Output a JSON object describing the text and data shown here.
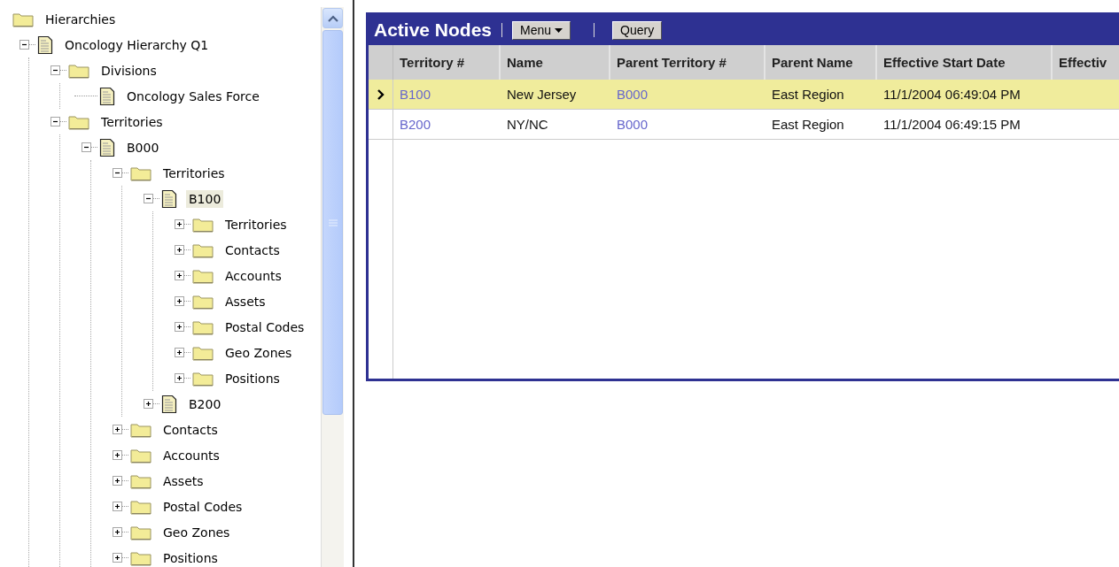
{
  "tree": {
    "label": "Hierarchies",
    "kind": "folder",
    "selected": false,
    "children": [
      {
        "label": "Oncology Hierarchy Q1",
        "kind": "document",
        "expanded": true,
        "selected": false,
        "children": [
          {
            "label": "Divisions",
            "kind": "folder",
            "expanded": true,
            "selected": false,
            "children": [
              {
                "label": "Oncology Sales Force",
                "kind": "document",
                "selected": false
              }
            ]
          },
          {
            "label": "Territories",
            "kind": "folder",
            "expanded": true,
            "selected": false,
            "children": [
              {
                "label": "B000",
                "kind": "document",
                "expanded": true,
                "selected": false,
                "children": [
                  {
                    "label": "Territories",
                    "kind": "folder",
                    "expanded": true,
                    "selected": false,
                    "children": [
                      {
                        "label": "B100",
                        "kind": "document",
                        "expanded": true,
                        "selected": true,
                        "children": [
                          {
                            "label": "Territories",
                            "kind": "folder",
                            "expanded": false,
                            "selected": false
                          },
                          {
                            "label": "Contacts",
                            "kind": "folder",
                            "expanded": false,
                            "selected": false
                          },
                          {
                            "label": "Accounts",
                            "kind": "folder",
                            "expanded": false,
                            "selected": false
                          },
                          {
                            "label": "Assets",
                            "kind": "folder",
                            "expanded": false,
                            "selected": false
                          },
                          {
                            "label": "Postal Codes",
                            "kind": "folder",
                            "expanded": false,
                            "selected": false
                          },
                          {
                            "label": "Geo Zones",
                            "kind": "folder",
                            "expanded": false,
                            "selected": false
                          },
                          {
                            "label": "Positions",
                            "kind": "folder",
                            "expanded": false,
                            "selected": false
                          }
                        ]
                      },
                      {
                        "label": "B200",
                        "kind": "document",
                        "expanded": false,
                        "selected": false
                      }
                    ]
                  },
                  {
                    "label": "Contacts",
                    "kind": "folder",
                    "expanded": false,
                    "selected": false
                  },
                  {
                    "label": "Accounts",
                    "kind": "folder",
                    "expanded": false,
                    "selected": false
                  },
                  {
                    "label": "Assets",
                    "kind": "folder",
                    "expanded": false,
                    "selected": false
                  },
                  {
                    "label": "Postal Codes",
                    "kind": "folder",
                    "expanded": false,
                    "selected": false
                  },
                  {
                    "label": "Geo Zones",
                    "kind": "folder",
                    "expanded": false,
                    "selected": false
                  },
                  {
                    "label": "Positions",
                    "kind": "folder",
                    "expanded": false,
                    "selected": false
                  }
                ]
              }
            ]
          }
        ]
      }
    ]
  },
  "panel": {
    "title": "Active Nodes",
    "buttons": [
      {
        "label": "Menu",
        "kind": "dropdown"
      },
      {
        "label": "Query",
        "kind": "plain"
      }
    ]
  },
  "table": {
    "columns": [
      {
        "label": "Territory #",
        "kind": "link"
      },
      {
        "label": "Name",
        "kind": "text"
      },
      {
        "label": "Parent Territory #",
        "kind": "link"
      },
      {
        "label": "Parent Name",
        "kind": "text"
      },
      {
        "label": "Effective Start Date",
        "kind": "text"
      },
      {
        "label": "Effectiv"
      }
    ],
    "rows": [
      {
        "selected": true,
        "cells": [
          "B100",
          "New Jersey",
          "B000",
          "East Region",
          "11/1/2004 06:49:04 PM"
        ]
      },
      {
        "selected": false,
        "cells": [
          "B200",
          "NY/NC",
          "B000",
          "East Region",
          "11/1/2004 06:49:15 PM"
        ]
      }
    ]
  }
}
